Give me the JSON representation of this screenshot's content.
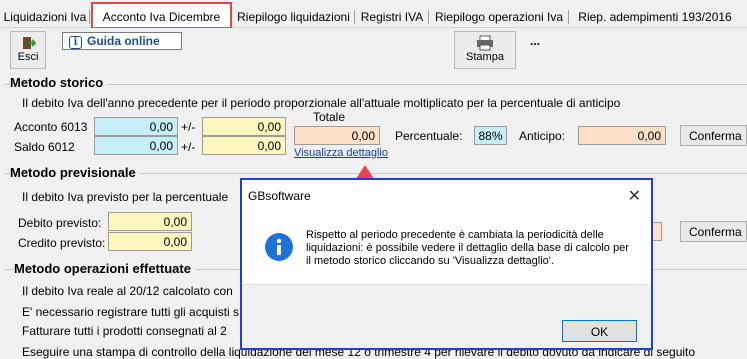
{
  "tabs": [
    {
      "label": "Liquidazioni Iva"
    },
    {
      "label": "Acconto Iva Dicembre"
    },
    {
      "label": "Riepilogo liquidazioni"
    },
    {
      "label": "Registri IVA"
    },
    {
      "label": "Riepilogo operazioni Iva"
    },
    {
      "label": "Riep. adempimenti 193/2016"
    }
  ],
  "toolbar": {
    "esci_label": "Esci",
    "guida_label": "Guida online",
    "stampa_label": "Stampa",
    "more_label": "..."
  },
  "storico": {
    "title": "Metodo storico",
    "description": "Il debito Iva dell'anno precedente per il periodo proporzionale all'attuale moltiplicato per la percentuale di anticipo",
    "acconto_label": "Acconto 6013",
    "acconto_value": "0,00",
    "acconto_pm": "+/-",
    "acconto_adj": "0,00",
    "saldo_label": "Saldo 6012",
    "saldo_value": "0,00",
    "saldo_pm": "+/-",
    "saldo_adj": "0,00",
    "totale_label": "Totale",
    "totale_value": "0,00",
    "dettaglio_link": "Visualizza dettaglio",
    "percentuale_label": "Percentuale:",
    "percentuale_value": "88%",
    "anticipo_label": "Anticipo:",
    "anticipo_value": "0,00",
    "conferma_label": "Conferma"
  },
  "previsionale": {
    "title": "Metodo previsionale",
    "description": "Il debito Iva previsto per la percentuale",
    "debito_label": "Debito previsto:",
    "debito_value": "0,00",
    "credito_label": "Credito previsto:",
    "credito_value": "0,00",
    "conferma_label": "Conferma"
  },
  "effettuate": {
    "title": "Metodo operazioni effettuate",
    "line1": "Il debito Iva reale al 20/12 calcolato con",
    "line2": "E' necessario registrare tutti gli acquisti s",
    "line3": "Fatturare tutti i prodotti consegnati al 2",
    "line4": "Eseguire una stampa di controllo della liquidazione del mese 12 o trimestre 4 per rilevare il debito dovuto da indicare di seguito"
  },
  "dialog": {
    "title": "GBsoftware",
    "close_label": "✕",
    "message": "Rispetto al periodo precedente è cambiata la periodicità delle liquidazioni: è possibile vedere il dettaglio della base di calcolo per il metodo storico cliccando su 'Visualizza dettaglio'.",
    "ok_label": "OK"
  },
  "colors": {
    "active_tab_border": "#e04848",
    "dialog_border": "#1f3fd6",
    "arrow": "#e8454a",
    "input_blue": "#c8eef8",
    "input_yellow": "#fdf6bf",
    "input_orange": "#fde0c6"
  }
}
